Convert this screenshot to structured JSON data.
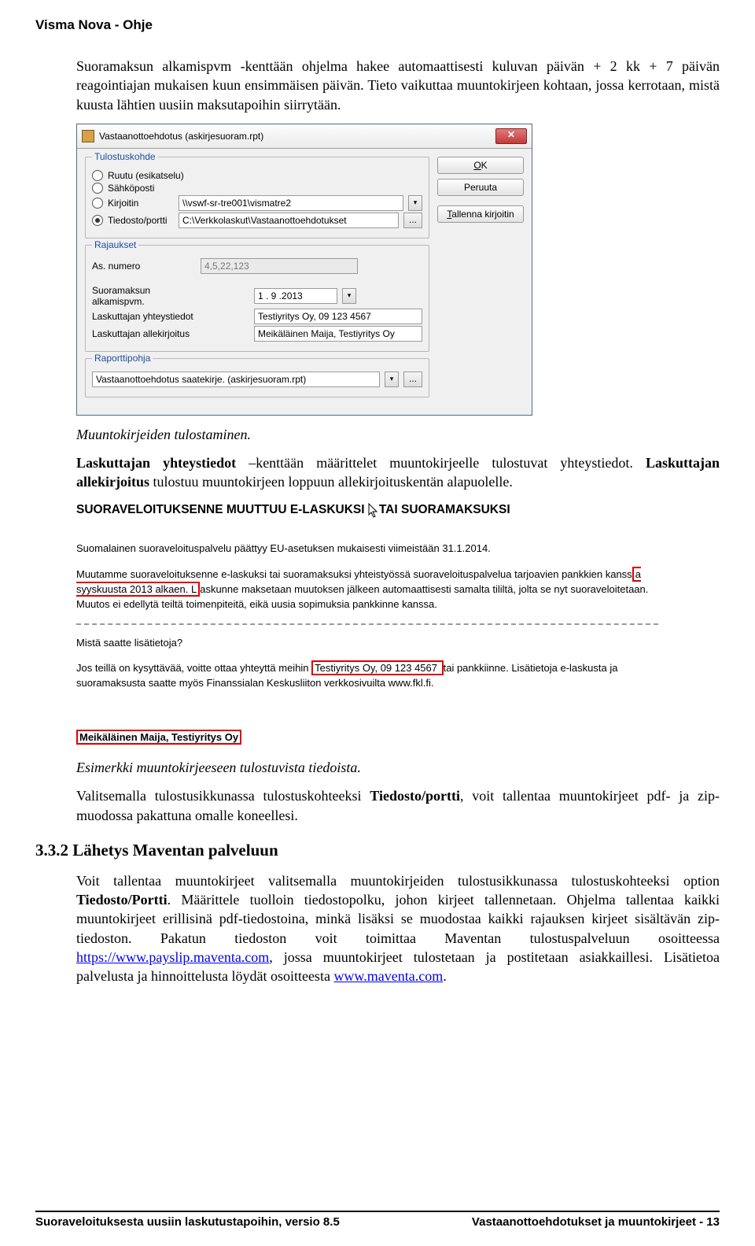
{
  "header": {
    "title": "Visma Nova - Ohje"
  },
  "intro": {
    "para": "Suoramaksun alkamispvm -kenttään ohjelma hakee automaattisesti kuluvan päivän + 2 kk + 7 päivän reagointiajan mukaisen kuun ensimmäisen päivän. Tieto vaikuttaa muuntokirjeen kohtaan, jossa kerrotaan, mistä kuusta lähtien uusiin maksutapoihin siirrytään."
  },
  "dialog": {
    "title": "Vastaanottoehdotus (askirjesuoram.rpt)",
    "groups": {
      "tulostus": {
        "legend": "Tulostuskohde",
        "options": {
          "ruutu": "Ruutu (esikatselu)",
          "sahko": "Sähköposti",
          "kirjoitin": "Kirjoitin",
          "tiedosto": "Tiedosto/portti"
        },
        "kirjoitin_value": "\\\\vswf-sr-tre001\\vismatre2",
        "tiedosto_value": "C:\\Verkkolaskut\\Vastaanottoehdotukset"
      },
      "rajaukset": {
        "legend": "Rajaukset",
        "as_label": "As. numero",
        "as_value": "4,5,22,123",
        "suoramaksu_label": "Suoramaksun alkamispvm.",
        "suoramaksu_value": "1 . 9 .2013",
        "yhteys_label": "Laskuttajan yhteystiedot",
        "yhteys_value": "Testiyritys Oy, 09 123 4567",
        "allek_label": "Laskuttajan allekirjoitus",
        "allek_value": "Meikäläinen Maija, Testiyritys Oy"
      },
      "raportti": {
        "legend": "Raporttipohja",
        "value": "Vastaanottoehdotus saatekirje. (askirjesuoram.rpt)"
      }
    },
    "buttons": {
      "ok": "OK",
      "peruuta": "Peruuta",
      "tallenna": "Tallenna kirjoitin"
    }
  },
  "caption1": "Muuntokirjeiden tulostaminen.",
  "para2": {
    "bold1": "Laskuttajan yhteystiedot",
    "rest1": " –kenttään määrittelet muuntokirjeelle tulostuvat yhteystiedot. ",
    "bold2": "Laskuttajan allekirjoitus",
    "rest2": " tulostuu muuntokirjeen loppuun allekirjoituskentän alapuolelle."
  },
  "snippet": {
    "heading": "SUORAVELOITUKSENNE MUUTTUU E-LASKUKSI TAI SUORAMAKSUKSI",
    "p1": "Suomalainen suoraveloituspalvelu päättyy EU-asetuksen mukaisesti viimeistään 31.1.2014.",
    "p2a": "Muutamme suoraveloituksenne e-laskuksi tai suoramaksuksi yhteistyössä suoraveloituspalvelua tarjoavien pankkien kanss",
    "p2_box": "a syyskuusta 2013 alkaen. L",
    "p2b": "askunne maksetaan muutoksen jälkeen automaattisesti samalta tililtä, jolta se nyt suoraveloitetaan. Muutos ei edellytä teiltä toimenpiteitä, eikä uusia sopimuksia pankkinne kanssa.",
    "q": "Mistä saatte lisätietoja?",
    "p3a": "Jos teillä on kysyttävää, voitte ottaa yhteyttä meihin ",
    "p3_box": "Testiyritys Oy, 09 123 4567 ",
    "p3b": "tai pankkiinne. Lisätietoja e-laskusta ja suoramaksusta saatte myös Finanssialan Keskusliiton verkkosivuilta www.fkl.fi.",
    "sign": "Meikäläinen Maija, Testiyritys Oy"
  },
  "caption2": "Esimerkki muuntokirjeeseen tulostuvista tiedoista.",
  "para3": {
    "a": "Valitsemalla tulostusikkunassa tulostuskohteeksi ",
    "b": "Tiedosto/portti",
    "c": ", voit tallentaa muuntokirjeet pdf- ja zip-muodossa pakattuna omalle koneellesi."
  },
  "section": {
    "heading": "3.3.2  Lähetys Maventan palveluun"
  },
  "para4": {
    "a": "Voit tallentaa muuntokirjeet valitsemalla muuntokirjeiden tulostusikkunassa tulostuskohteeksi option ",
    "b": "Tiedosto/Portti",
    "c": ". Määrittele tuolloin tiedostopolku, johon kirjeet tallennetaan. Ohjelma tallentaa kaikki muuntokirjeet erillisinä pdf-tiedostoina, minkä lisäksi se muodostaa kaikki rajauksen kirjeet sisältävän zip-tiedoston. Pakatun tiedoston voit toimittaa Maventan tulostuspalveluun osoitteessa ",
    "link1": "https://www.payslip.maventa.com",
    "d": ", jossa muuntokirjeet tulostetaan ja postitetaan asiakkaillesi. Lisätietoa palvelusta ja hinnoittelusta löydät osoitteesta ",
    "link2": "www.maventa.com",
    "e": "."
  },
  "footer": {
    "left": "Suoraveloituksesta uusiin laskutustapoihin, versio 8.5",
    "right": "Vastaanottoehdotukset ja muuntokirjeet - 13"
  }
}
